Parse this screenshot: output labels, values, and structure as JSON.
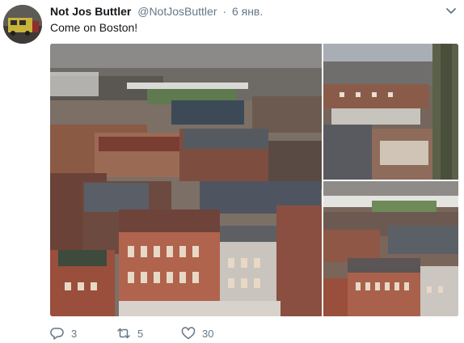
{
  "tweet": {
    "display_name": "Not Jos Buttler",
    "handle": "@NotJosButtler",
    "separator": "·",
    "time": "6 янв.",
    "text": "Come on Boston!"
  },
  "icons": {
    "avatar": "avatar-image",
    "menu": "chevron-down-icon",
    "reply": "reply-icon",
    "retweet": "retweet-icon",
    "like": "heart-icon"
  },
  "media": {
    "photos": [
      {
        "subject": "aerial-town-photo"
      },
      {
        "subject": "aerial-town-church-tower-photo"
      },
      {
        "subject": "aerial-town-stadium-photo"
      }
    ]
  },
  "actions": {
    "replies": "3",
    "retweets": "5",
    "likes": "30"
  },
  "colors": {
    "text": "#14171a",
    "muted": "#657786"
  }
}
